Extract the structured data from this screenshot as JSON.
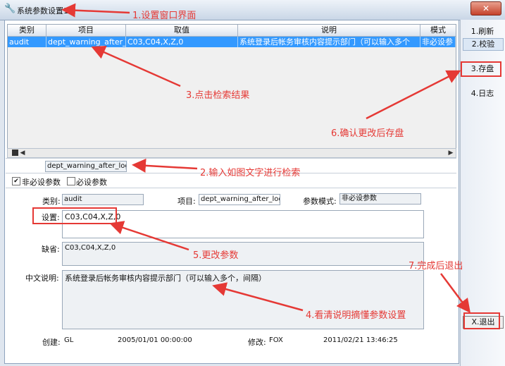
{
  "window": {
    "title": "系统参数设置1",
    "close_label": "✕"
  },
  "grid": {
    "columns": [
      "类别",
      "项目",
      "取值",
      "说明",
      "模式"
    ],
    "rows": [
      [
        "audit",
        "dept_warning_after_login",
        "C03,C04,X,Z,0",
        "系统登录后帐务审核内容提示部门（可以输入多个",
        "非必设参"
      ]
    ]
  },
  "search": {
    "value": "dept_warning_after_login"
  },
  "filters": {
    "optional_label": "非必设参数",
    "optional_checked": true,
    "required_label": "必设参数",
    "required_checked": false
  },
  "form": {
    "category_label": "类别:",
    "category_value": "audit",
    "item_label": "项目:",
    "item_value": "dept_warning_after_login",
    "mode_label": "参数模式:",
    "mode_value": "非必设参数",
    "setting_label": "设置:",
    "setting_value": "C03,C04,X,Z,0",
    "default_label": "缺省:",
    "default_value": "C03,C04,X,Z,0",
    "desc_label": "中文说明:",
    "desc_value": "系统登录后帐务审核内容提示部门（可以输入多个，间隔）",
    "created_label": "创建:",
    "created_by": "GL",
    "created_at": "2005/01/01 00:00:00",
    "modified_label": "修改:",
    "modified_by": "FOX",
    "modified_at": "2011/02/21 13:46:25"
  },
  "side_buttons": {
    "refresh": "1.刷新",
    "verify": "2.校验",
    "save": "3.存盘",
    "log": "4.日志",
    "exit": "X.退出"
  },
  "annotations": {
    "a1": "1.设置窗口界面",
    "a2": "2.输入如图文字进行检索",
    "a3": "3.点击检索结果",
    "a4": "4.看清说明摘懂参数设置",
    "a5": "5.更改参数",
    "a6": "6.确认更改后存盘",
    "a7": "7.完成后退出"
  },
  "colors": {
    "annotation": "#e53935",
    "selection": "#3399ff"
  }
}
